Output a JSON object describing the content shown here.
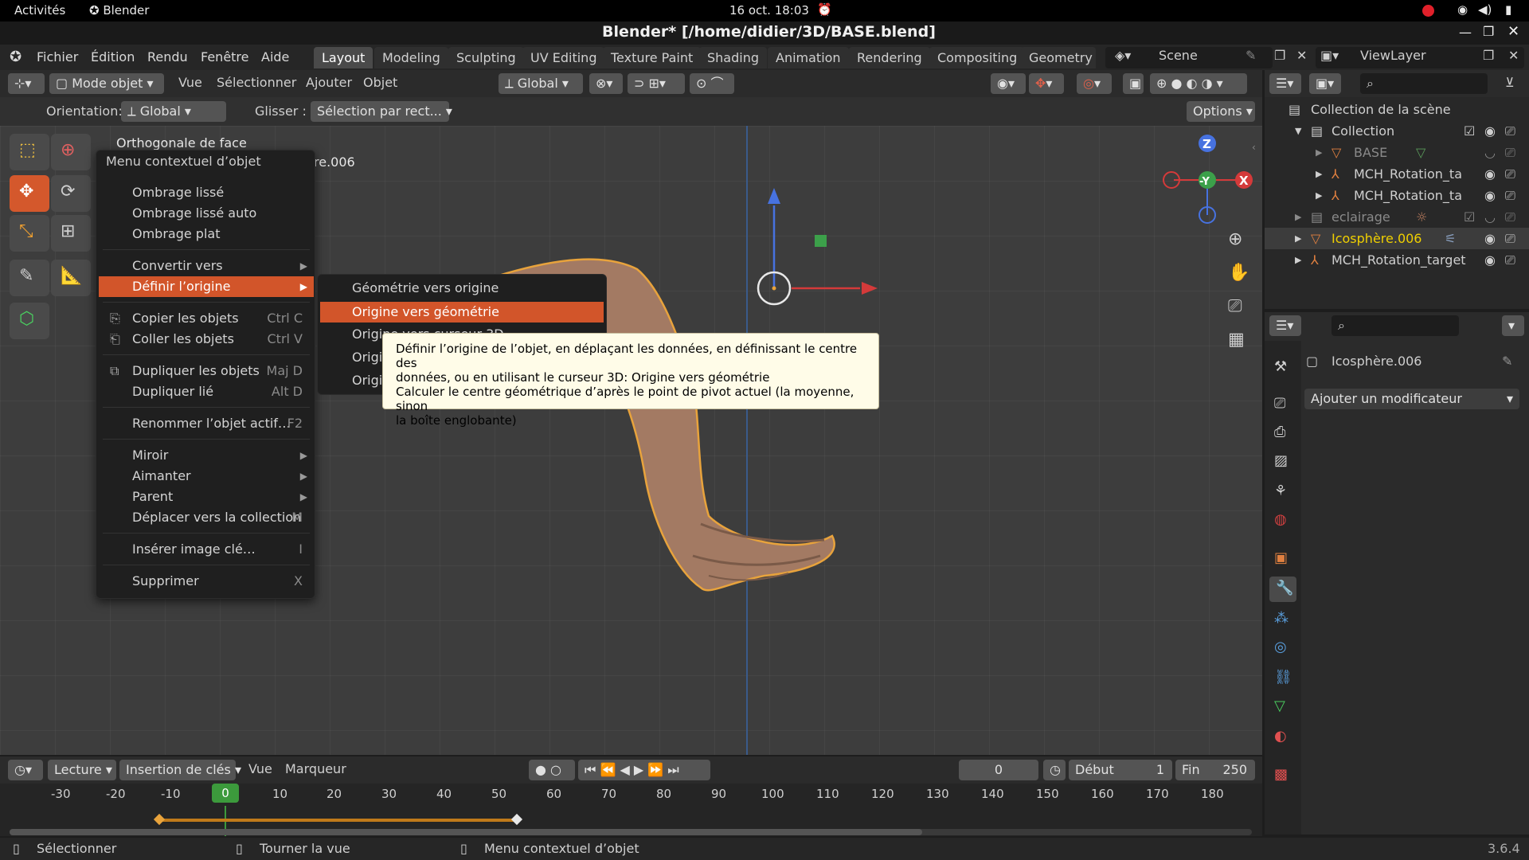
{
  "system": {
    "activities": "Activités",
    "app": "Blender",
    "datetime": "16 oct.  18:03"
  },
  "window": {
    "title": "Blender* [/home/didier/3D/BASE.blend]"
  },
  "menubar": {
    "items": [
      "Fichier",
      "Édition",
      "Rendu",
      "Fenêtre",
      "Aide"
    ]
  },
  "workspaces": [
    "Layout",
    "Modeling",
    "Sculpting",
    "UV Editing",
    "Texture Paint",
    "Shading",
    "Animation",
    "Rendering",
    "Compositing",
    "Geometry N"
  ],
  "scene": {
    "label": "Scene",
    "viewlayer": "ViewLayer"
  },
  "header3d": {
    "mode": "Mode objet",
    "menus": [
      "Vue",
      "Sélectionner",
      "Ajouter",
      "Objet"
    ],
    "transform": "Global"
  },
  "toolheader": {
    "orientation_label": "Orientation:",
    "orientation_value": "Global",
    "drag_label": "Glisser :",
    "drag_value": "Sélection par rect...",
    "options": "Options"
  },
  "viewport": {
    "view_name": "Orthogonale de face",
    "object_name": "re.006"
  },
  "context_menu": {
    "title": "Menu contextuel d’objet",
    "items": [
      {
        "label": "Ombrage lissé",
        "shortcut": ""
      },
      {
        "label": "Ombrage lissé auto",
        "shortcut": ""
      },
      {
        "label": "Ombrage plat",
        "shortcut": ""
      },
      {
        "label": "Convertir vers",
        "shortcut": "▸"
      },
      {
        "label": "Définir l’origine",
        "shortcut": "▸"
      },
      {
        "label": "Copier les objets",
        "shortcut": "Ctrl C"
      },
      {
        "label": "Coller les objets",
        "shortcut": "Ctrl V"
      },
      {
        "label": "Dupliquer les objets",
        "shortcut": "Maj D"
      },
      {
        "label": "Dupliquer lié",
        "shortcut": "Alt D"
      },
      {
        "label": "Renommer l’objet actif…",
        "shortcut": "F2"
      },
      {
        "label": "Miroir",
        "shortcut": "▸"
      },
      {
        "label": "Aimanter",
        "shortcut": "▸"
      },
      {
        "label": "Parent",
        "shortcut": "▸"
      },
      {
        "label": "Déplacer vers la collection",
        "shortcut": "M"
      },
      {
        "label": "Insérer image clé…",
        "shortcut": "I"
      },
      {
        "label": "Supprimer",
        "shortcut": "X"
      }
    ]
  },
  "submenu": {
    "items": [
      "Géométrie vers origine",
      "Origine vers géométrie",
      "Origine vers curseur 3D",
      "Origi",
      "Origi"
    ]
  },
  "tooltip": {
    "line1": "Définir l’origine de l’objet, en déplaçant les données, en définissant le centre des",
    "line2": "données, ou en utilisant le curseur 3D:  Origine vers géométrie",
    "line3": "Calculer le centre géométrique d’après le point de pivot actuel (la moyenne, sinon",
    "line4": "la boîte englobante)"
  },
  "outliner": {
    "root": "Collection de la scène",
    "rows": [
      "Collection",
      "BASE",
      "MCH_Rotation_ta",
      "MCH_Rotation_ta",
      "eclairage",
      "Icosphère.006",
      "MCH_Rotation_target"
    ]
  },
  "properties": {
    "object": "Icosphère.006",
    "add_modifier": "Ajouter un modificateur"
  },
  "timeline": {
    "playback": "Lecture",
    "keying": "Insertion de clés",
    "view": "Vue",
    "marker": "Marqueur",
    "current": "0",
    "start_label": "Début",
    "start": "1",
    "end_label": "Fin",
    "end": "250",
    "ticks": [
      "-30",
      "-20",
      "-10",
      "0",
      "10",
      "20",
      "30",
      "40",
      "50",
      "60",
      "70",
      "80",
      "90",
      "100",
      "110",
      "120",
      "130",
      "140",
      "150",
      "160",
      "170",
      "180"
    ]
  },
  "statusbar": {
    "left": "Sélectionner",
    "mid": "Tourner la vue",
    "right": "Menu contextuel d’objet",
    "version": "3.6.4"
  },
  "colors": {
    "accent": "#d2552a",
    "selection_orange": "#e8a33c",
    "blue_axis": "#4772b3"
  }
}
